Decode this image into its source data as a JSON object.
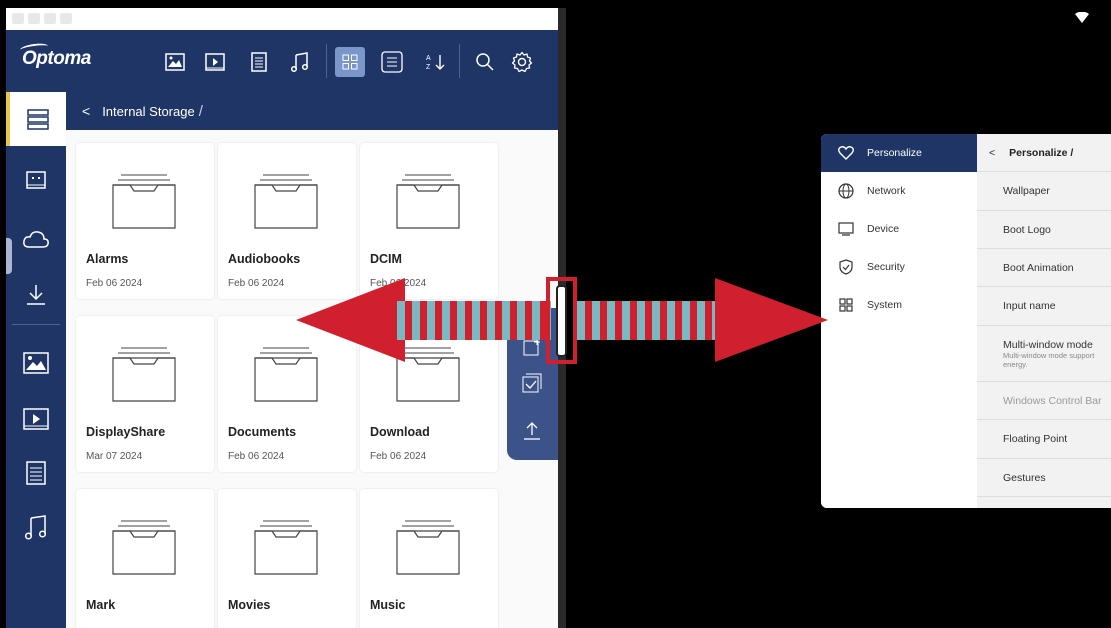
{
  "left_app": {
    "brand": "Optoma",
    "breadcrumb": {
      "location": "Internal Storage",
      "separator": "/"
    },
    "toolbar_icons": [
      "image-icon",
      "video-icon",
      "document-icon",
      "music-icon",
      "grid-view-icon",
      "list-view-icon",
      "sort-icon",
      "search-icon",
      "settings-gear-icon"
    ],
    "sidebar_icons": [
      "storage-icon",
      "device-icon",
      "cloud-icon",
      "download-icon",
      "image-icon",
      "video-icon",
      "document-icon",
      "music-icon"
    ],
    "folders": [
      {
        "name": "Alarms",
        "date": "Feb 06 2024"
      },
      {
        "name": "Audiobooks",
        "date": "Feb 06 2024"
      },
      {
        "name": "DCIM",
        "date": "Feb 06 2024"
      },
      {
        "name": "DisplayShare",
        "date": "Mar 07 2024"
      },
      {
        "name": "Documents",
        "date": "Feb 06 2024"
      },
      {
        "name": "Download",
        "date": "Feb 06 2024"
      },
      {
        "name": "Mark",
        "date": ""
      },
      {
        "name": "Movies",
        "date": ""
      },
      {
        "name": "Music",
        "date": ""
      }
    ],
    "colors": {
      "header": "#1e3566",
      "accent": "#e8c64a"
    }
  },
  "right_app": {
    "categories": [
      {
        "label": "Personalize",
        "icon": "heart-icon"
      },
      {
        "label": "Network",
        "icon": "globe-icon"
      },
      {
        "label": "Device",
        "icon": "monitor-icon"
      },
      {
        "label": "Security",
        "icon": "shield-icon"
      },
      {
        "label": "System",
        "icon": "apps-grid-icon"
      }
    ],
    "header": {
      "back": "<",
      "title": "Personalize /"
    },
    "options": [
      {
        "label": "Wallpaper",
        "sub": ""
      },
      {
        "label": "Boot Logo",
        "sub": ""
      },
      {
        "label": "Boot Animation",
        "sub": ""
      },
      {
        "label": "Input name",
        "sub": ""
      },
      {
        "label": "Multi-window mode",
        "sub": "Multi-window mode support energy."
      },
      {
        "label": "Windows Control Bar",
        "sub": ""
      },
      {
        "label": "Floating Point",
        "sub": ""
      },
      {
        "label": "Gestures",
        "sub": ""
      }
    ]
  },
  "overlay": {
    "type": "double-headed-drag-arrow",
    "colors": {
      "arrow": "#d0202e",
      "stripe": "#7ab8c2"
    }
  }
}
